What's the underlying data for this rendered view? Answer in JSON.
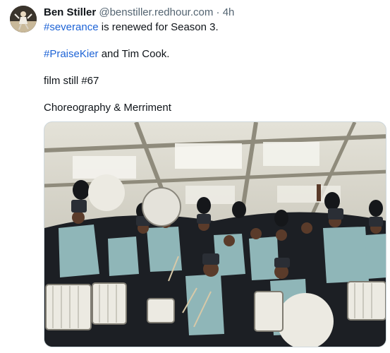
{
  "post": {
    "author": {
      "display_name": "Ben Stiller",
      "handle": "@benstiller.redhour.com",
      "separator": "·",
      "time": "4h"
    },
    "lines": [
      {
        "hashtag": "#severance",
        "text": " is renewed for Season 3."
      },
      {
        "hashtag": "#PraiseKier",
        "text": " and Tim Cook."
      },
      {
        "hashtag": "",
        "text": "film still #67"
      },
      {
        "hashtag": "",
        "text": "Choreography & Merriment"
      }
    ],
    "media": {
      "kind": "photo",
      "colors": {
        "ceiling": "#d8d6cc",
        "ceiling_shadow": "#9a9686",
        "uniform_teal": "#8fb6b8",
        "uniform_dark": "#1c1f24",
        "drum_white": "#eceae2",
        "floor": "#3e5a3a"
      }
    },
    "colors": {
      "hashtag": "#1d63d6",
      "secondary_text": "#536471",
      "border": "#cfd9de"
    }
  }
}
